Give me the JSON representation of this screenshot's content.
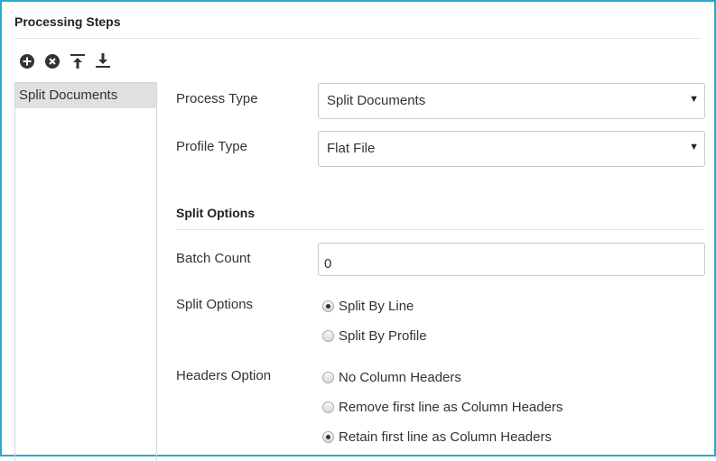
{
  "header": {
    "title": "Processing Steps"
  },
  "toolbar": {
    "buttons": [
      {
        "icon": "add-circle-icon"
      },
      {
        "icon": "remove-circle-icon"
      },
      {
        "icon": "move-top-icon"
      },
      {
        "icon": "move-bottom-icon"
      }
    ]
  },
  "steps": {
    "items": [
      {
        "label": "Split Documents",
        "selected": true
      }
    ]
  },
  "form": {
    "process_type": {
      "label": "Process Type",
      "value": "Split Documents"
    },
    "profile_type": {
      "label": "Profile Type",
      "value": "Flat File"
    },
    "split_section_title": "Split Options",
    "batch_count": {
      "label": "Batch Count",
      "value": "0"
    },
    "split_options": {
      "label": "Split Options",
      "options": [
        {
          "label": "Split By Line",
          "selected": true
        },
        {
          "label": "Split By Profile",
          "selected": false
        }
      ]
    },
    "headers_option": {
      "label": "Headers Option",
      "options": [
        {
          "label": "No Column Headers",
          "selected": false
        },
        {
          "label": "Remove first line as Column Headers",
          "selected": false
        },
        {
          "label": "Retain first line as Column Headers",
          "selected": true
        }
      ]
    }
  },
  "colors": {
    "frame_border": "#2aa9c9",
    "selected_bg": "#e0e0e0"
  }
}
